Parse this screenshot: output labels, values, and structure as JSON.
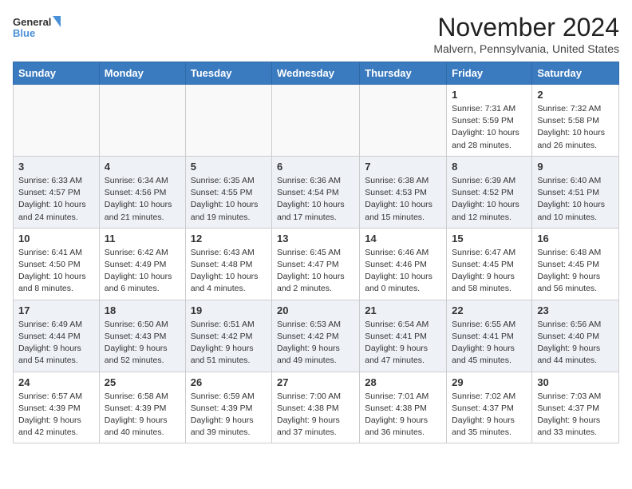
{
  "header": {
    "logo_general": "General",
    "logo_blue": "Blue",
    "month_title": "November 2024",
    "location": "Malvern, Pennsylvania, United States"
  },
  "weekdays": [
    "Sunday",
    "Monday",
    "Tuesday",
    "Wednesday",
    "Thursday",
    "Friday",
    "Saturday"
  ],
  "weeks": [
    [
      {
        "day": "",
        "info": ""
      },
      {
        "day": "",
        "info": ""
      },
      {
        "day": "",
        "info": ""
      },
      {
        "day": "",
        "info": ""
      },
      {
        "day": "",
        "info": ""
      },
      {
        "day": "1",
        "info": "Sunrise: 7:31 AM\nSunset: 5:59 PM\nDaylight: 10 hours\nand 28 minutes."
      },
      {
        "day": "2",
        "info": "Sunrise: 7:32 AM\nSunset: 5:58 PM\nDaylight: 10 hours\nand 26 minutes."
      }
    ],
    [
      {
        "day": "3",
        "info": "Sunrise: 6:33 AM\nSunset: 4:57 PM\nDaylight: 10 hours\nand 24 minutes."
      },
      {
        "day": "4",
        "info": "Sunrise: 6:34 AM\nSunset: 4:56 PM\nDaylight: 10 hours\nand 21 minutes."
      },
      {
        "day": "5",
        "info": "Sunrise: 6:35 AM\nSunset: 4:55 PM\nDaylight: 10 hours\nand 19 minutes."
      },
      {
        "day": "6",
        "info": "Sunrise: 6:36 AM\nSunset: 4:54 PM\nDaylight: 10 hours\nand 17 minutes."
      },
      {
        "day": "7",
        "info": "Sunrise: 6:38 AM\nSunset: 4:53 PM\nDaylight: 10 hours\nand 15 minutes."
      },
      {
        "day": "8",
        "info": "Sunrise: 6:39 AM\nSunset: 4:52 PM\nDaylight: 10 hours\nand 12 minutes."
      },
      {
        "day": "9",
        "info": "Sunrise: 6:40 AM\nSunset: 4:51 PM\nDaylight: 10 hours\nand 10 minutes."
      }
    ],
    [
      {
        "day": "10",
        "info": "Sunrise: 6:41 AM\nSunset: 4:50 PM\nDaylight: 10 hours\nand 8 minutes."
      },
      {
        "day": "11",
        "info": "Sunrise: 6:42 AM\nSunset: 4:49 PM\nDaylight: 10 hours\nand 6 minutes."
      },
      {
        "day": "12",
        "info": "Sunrise: 6:43 AM\nSunset: 4:48 PM\nDaylight: 10 hours\nand 4 minutes."
      },
      {
        "day": "13",
        "info": "Sunrise: 6:45 AM\nSunset: 4:47 PM\nDaylight: 10 hours\nand 2 minutes."
      },
      {
        "day": "14",
        "info": "Sunrise: 6:46 AM\nSunset: 4:46 PM\nDaylight: 10 hours\nand 0 minutes."
      },
      {
        "day": "15",
        "info": "Sunrise: 6:47 AM\nSunset: 4:45 PM\nDaylight: 9 hours\nand 58 minutes."
      },
      {
        "day": "16",
        "info": "Sunrise: 6:48 AM\nSunset: 4:45 PM\nDaylight: 9 hours\nand 56 minutes."
      }
    ],
    [
      {
        "day": "17",
        "info": "Sunrise: 6:49 AM\nSunset: 4:44 PM\nDaylight: 9 hours\nand 54 minutes."
      },
      {
        "day": "18",
        "info": "Sunrise: 6:50 AM\nSunset: 4:43 PM\nDaylight: 9 hours\nand 52 minutes."
      },
      {
        "day": "19",
        "info": "Sunrise: 6:51 AM\nSunset: 4:42 PM\nDaylight: 9 hours\nand 51 minutes."
      },
      {
        "day": "20",
        "info": "Sunrise: 6:53 AM\nSunset: 4:42 PM\nDaylight: 9 hours\nand 49 minutes."
      },
      {
        "day": "21",
        "info": "Sunrise: 6:54 AM\nSunset: 4:41 PM\nDaylight: 9 hours\nand 47 minutes."
      },
      {
        "day": "22",
        "info": "Sunrise: 6:55 AM\nSunset: 4:41 PM\nDaylight: 9 hours\nand 45 minutes."
      },
      {
        "day": "23",
        "info": "Sunrise: 6:56 AM\nSunset: 4:40 PM\nDaylight: 9 hours\nand 44 minutes."
      }
    ],
    [
      {
        "day": "24",
        "info": "Sunrise: 6:57 AM\nSunset: 4:39 PM\nDaylight: 9 hours\nand 42 minutes."
      },
      {
        "day": "25",
        "info": "Sunrise: 6:58 AM\nSunset: 4:39 PM\nDaylight: 9 hours\nand 40 minutes."
      },
      {
        "day": "26",
        "info": "Sunrise: 6:59 AM\nSunset: 4:39 PM\nDaylight: 9 hours\nand 39 minutes."
      },
      {
        "day": "27",
        "info": "Sunrise: 7:00 AM\nSunset: 4:38 PM\nDaylight: 9 hours\nand 37 minutes."
      },
      {
        "day": "28",
        "info": "Sunrise: 7:01 AM\nSunset: 4:38 PM\nDaylight: 9 hours\nand 36 minutes."
      },
      {
        "day": "29",
        "info": "Sunrise: 7:02 AM\nSunset: 4:37 PM\nDaylight: 9 hours\nand 35 minutes."
      },
      {
        "day": "30",
        "info": "Sunrise: 7:03 AM\nSunset: 4:37 PM\nDaylight: 9 hours\nand 33 minutes."
      }
    ]
  ]
}
